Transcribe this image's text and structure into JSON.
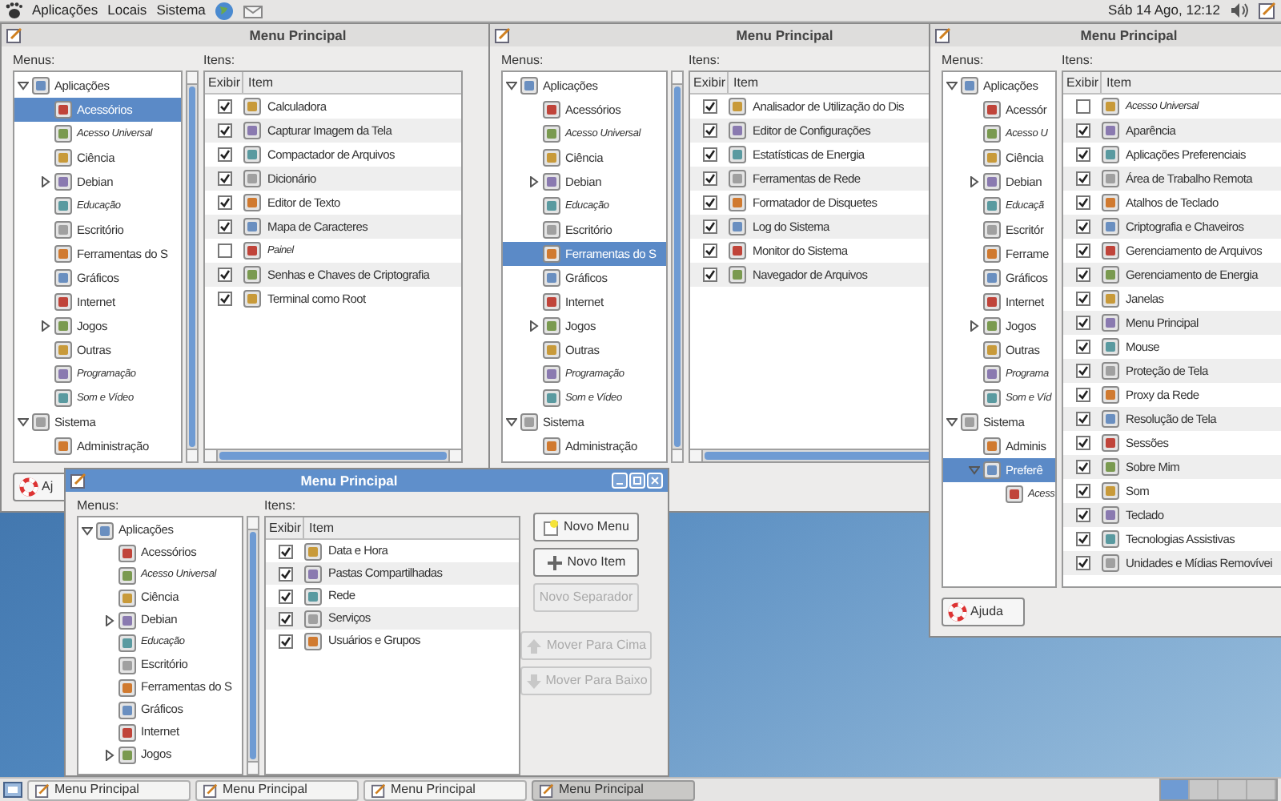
{
  "top_panel": {
    "menus": [
      "Aplicações",
      "Locais",
      "Sistema"
    ],
    "clock": "Sáb 14 Ago, 12:12"
  },
  "windows": [
    {
      "title": "Menu Principal",
      "active": false,
      "menus_label": "Menus:",
      "items_label": "Itens:",
      "columns": [
        "Exibir",
        "Item"
      ],
      "tree": [
        {
          "label": "Aplicações",
          "selected": false,
          "hidden": false,
          "expanded": true,
          "children": [
            {
              "label": "Acessórios",
              "selected": true,
              "hidden": false
            },
            {
              "label": "Acesso Universal",
              "selected": false,
              "hidden": true
            },
            {
              "label": "Ciência",
              "selected": false,
              "hidden": false
            },
            {
              "label": "Debian",
              "selected": false,
              "hidden": false,
              "expanded": false
            },
            {
              "label": "Educação",
              "selected": false,
              "hidden": true
            },
            {
              "label": "Escritório",
              "selected": false,
              "hidden": false
            },
            {
              "label": "Ferramentas do S",
              "selected": false,
              "hidden": false
            },
            {
              "label": "Gráficos",
              "selected": false,
              "hidden": false
            },
            {
              "label": "Internet",
              "selected": false,
              "hidden": false
            },
            {
              "label": "Jogos",
              "selected": false,
              "hidden": false,
              "expanded": false
            },
            {
              "label": "Outras",
              "selected": false,
              "hidden": false
            },
            {
              "label": "Programação",
              "selected": false,
              "hidden": true
            },
            {
              "label": "Som e Vídeo",
              "selected": false,
              "hidden": true
            }
          ]
        },
        {
          "label": "Sistema",
          "selected": false,
          "hidden": false,
          "expanded": true,
          "children": [
            {
              "label": "Administração",
              "selected": false,
              "hidden": false
            }
          ]
        }
      ],
      "items": [
        {
          "label": "Calculadora",
          "checked": true
        },
        {
          "label": "Capturar Imagem da Tela",
          "checked": true
        },
        {
          "label": "Compactador de Arquivos",
          "checked": true
        },
        {
          "label": "Dicionário",
          "checked": true
        },
        {
          "label": "Editor de Texto",
          "checked": true
        },
        {
          "label": "Mapa de Caracteres",
          "checked": true
        },
        {
          "label": "Painel",
          "checked": false
        },
        {
          "label": "Senhas e Chaves de Criptografia",
          "checked": true
        },
        {
          "label": "Terminal como Root",
          "checked": true
        }
      ],
      "help_button": "Aj"
    },
    {
      "title": "Menu Principal",
      "active": false,
      "menus_label": "Menus:",
      "items_label": "Itens:",
      "columns": [
        "Exibir",
        "Item"
      ],
      "tree": [
        {
          "label": "Aplicações",
          "selected": false,
          "hidden": false,
          "expanded": true,
          "children": [
            {
              "label": "Acessórios",
              "selected": false,
              "hidden": false
            },
            {
              "label": "Acesso Universal",
              "selected": false,
              "hidden": true
            },
            {
              "label": "Ciência",
              "selected": false,
              "hidden": false
            },
            {
              "label": "Debian",
              "selected": false,
              "hidden": false,
              "expanded": false
            },
            {
              "label": "Educação",
              "selected": false,
              "hidden": true
            },
            {
              "label": "Escritório",
              "selected": false,
              "hidden": false
            },
            {
              "label": "Ferramentas do S",
              "selected": true,
              "hidden": false
            },
            {
              "label": "Gráficos",
              "selected": false,
              "hidden": false
            },
            {
              "label": "Internet",
              "selected": false,
              "hidden": false
            },
            {
              "label": "Jogos",
              "selected": false,
              "hidden": false,
              "expanded": false
            },
            {
              "label": "Outras",
              "selected": false,
              "hidden": false
            },
            {
              "label": "Programação",
              "selected": false,
              "hidden": true
            },
            {
              "label": "Som e Vídeo",
              "selected": false,
              "hidden": true
            }
          ]
        },
        {
          "label": "Sistema",
          "selected": false,
          "hidden": false,
          "expanded": true,
          "children": [
            {
              "label": "Administração",
              "selected": false,
              "hidden": false
            }
          ]
        }
      ],
      "items": [
        {
          "label": "Analisador de Utilização do Dis",
          "checked": true
        },
        {
          "label": "Editor de Configurações",
          "checked": true
        },
        {
          "label": "Estatísticas de Energia",
          "checked": true
        },
        {
          "label": "Ferramentas de Rede",
          "checked": true
        },
        {
          "label": "Formatador de Disquetes",
          "checked": true
        },
        {
          "label": "Log do Sistema",
          "checked": true
        },
        {
          "label": "Monitor do Sistema",
          "checked": true
        },
        {
          "label": "Navegador de Arquivos",
          "checked": true
        }
      ]
    },
    {
      "title": "Menu Principal",
      "active": false,
      "menus_label": "Menus:",
      "items_label": "Itens:",
      "columns": [
        "Exibir",
        "Item"
      ],
      "tree": [
        {
          "label": "Aplicações",
          "selected": false,
          "hidden": false,
          "expanded": true,
          "children": [
            {
              "label": "Acessór",
              "selected": false,
              "hidden": false
            },
            {
              "label": "Acesso U",
              "selected": false,
              "hidden": true
            },
            {
              "label": "Ciência",
              "selected": false,
              "hidden": false
            },
            {
              "label": "Debian",
              "selected": false,
              "hidden": false,
              "expanded": false
            },
            {
              "label": "Educaçã",
              "selected": false,
              "hidden": true
            },
            {
              "label": "Escritór",
              "selected": false,
              "hidden": false
            },
            {
              "label": "Ferrame",
              "selected": false,
              "hidden": false
            },
            {
              "label": "Gráficos",
              "selected": false,
              "hidden": false
            },
            {
              "label": "Internet",
              "selected": false,
              "hidden": false
            },
            {
              "label": "Jogos",
              "selected": false,
              "hidden": false,
              "expanded": false
            },
            {
              "label": "Outras",
              "selected": false,
              "hidden": false
            },
            {
              "label": "Programa",
              "selected": false,
              "hidden": true
            },
            {
              "label": "Som e Víd",
              "selected": false,
              "hidden": true
            }
          ]
        },
        {
          "label": "Sistema",
          "selected": false,
          "hidden": false,
          "expanded": true,
          "children": [
            {
              "label": "Adminis",
              "selected": false,
              "hidden": false
            },
            {
              "label": "Preferê",
              "selected": true,
              "hidden": false,
              "expanded": true,
              "children": [
                {
                  "label": "Acess",
                  "selected": false,
                  "hidden": true
                }
              ]
            }
          ]
        }
      ],
      "items": [
        {
          "label": "Acesso Universal",
          "checked": false
        },
        {
          "label": "Aparência",
          "checked": true
        },
        {
          "label": "Aplicações Preferenciais",
          "checked": true
        },
        {
          "label": "Área de Trabalho Remota",
          "checked": true
        },
        {
          "label": "Atalhos de Teclado",
          "checked": true
        },
        {
          "label": "Criptografia e Chaveiros",
          "checked": true
        },
        {
          "label": "Gerenciamento de Arquivos",
          "checked": true
        },
        {
          "label": "Gerenciamento de Energia",
          "checked": true
        },
        {
          "label": "Janelas",
          "checked": true
        },
        {
          "label": "Menu Principal",
          "checked": true
        },
        {
          "label": "Mouse",
          "checked": true
        },
        {
          "label": "Proteção de Tela",
          "checked": true
        },
        {
          "label": "Proxy da Rede",
          "checked": true
        },
        {
          "label": "Resolução de Tela",
          "checked": true
        },
        {
          "label": "Sessões",
          "checked": true
        },
        {
          "label": "Sobre Mim",
          "checked": true
        },
        {
          "label": "Som",
          "checked": true
        },
        {
          "label": "Teclado",
          "checked": true
        },
        {
          "label": "Tecnologias Assistivas",
          "checked": true
        },
        {
          "label": "Unidades e Mídias Removívei",
          "checked": true
        }
      ],
      "help_button": "Ajuda"
    },
    {
      "title": "Menu Principal",
      "active": true,
      "menus_label": "Menus:",
      "items_label": "Itens:",
      "columns": [
        "Exibir",
        "Item"
      ],
      "tree": [
        {
          "label": "Aplicações",
          "selected": false,
          "hidden": false,
          "expanded": true,
          "children": [
            {
              "label": "Acessórios",
              "selected": false,
              "hidden": false
            },
            {
              "label": "Acesso Universal",
              "selected": false,
              "hidden": true
            },
            {
              "label": "Ciência",
              "selected": false,
              "hidden": false
            },
            {
              "label": "Debian",
              "selected": false,
              "hidden": false,
              "expanded": false
            },
            {
              "label": "Educação",
              "selected": false,
              "hidden": true
            },
            {
              "label": "Escritório",
              "selected": false,
              "hidden": false
            },
            {
              "label": "Ferramentas do S",
              "selected": false,
              "hidden": false
            },
            {
              "label": "Gráficos",
              "selected": false,
              "hidden": false
            },
            {
              "label": "Internet",
              "selected": false,
              "hidden": false
            },
            {
              "label": "Jogos",
              "selected": false,
              "hidden": false,
              "expanded": false
            }
          ]
        }
      ],
      "items": [
        {
          "label": "Data e Hora",
          "checked": true
        },
        {
          "label": "Pastas Compartilhadas",
          "checked": true
        },
        {
          "label": "Rede",
          "checked": true
        },
        {
          "label": "Serviços",
          "checked": true
        },
        {
          "label": "Usuários e Grupos",
          "checked": true
        }
      ],
      "buttons": [
        {
          "label": "Novo Menu",
          "disabled": false
        },
        {
          "label": "Novo Item",
          "disabled": false
        },
        {
          "label": "Novo Separador",
          "disabled": true
        },
        {
          "label": "Mover Para Cima",
          "disabled": true
        },
        {
          "label": "Mover Para Baixo",
          "disabled": true
        }
      ]
    }
  ],
  "taskbar": {
    "tasks": [
      {
        "label": "Menu Principal",
        "selected": false
      },
      {
        "label": "Menu Principal",
        "selected": false
      },
      {
        "label": "Menu Principal",
        "selected": false
      },
      {
        "label": "Menu Principal",
        "selected": true
      }
    ],
    "workspaces": [
      {
        "selected": true
      },
      {
        "selected": false
      },
      {
        "selected": false
      },
      {
        "selected": false
      }
    ]
  }
}
